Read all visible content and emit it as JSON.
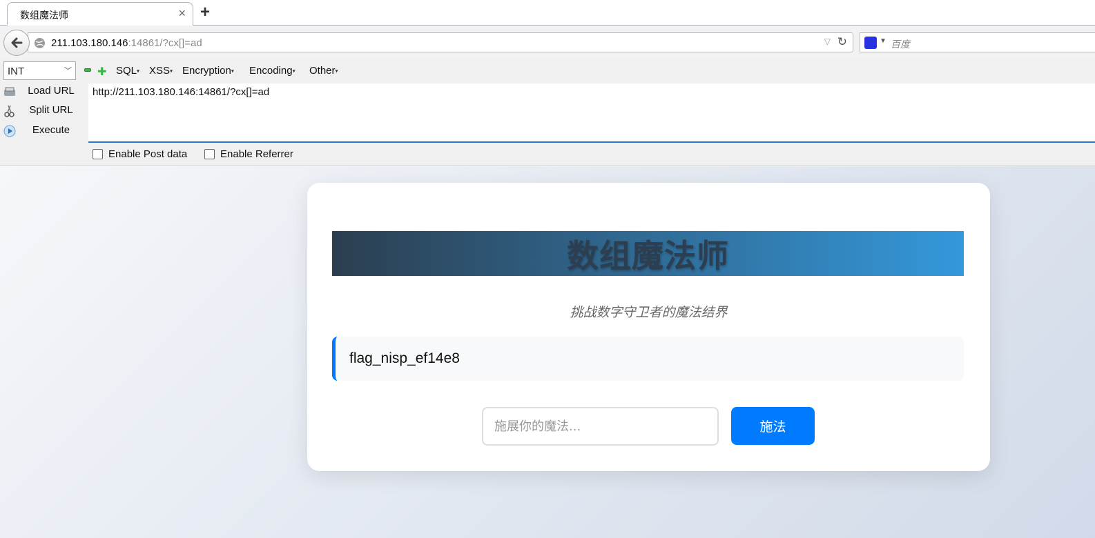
{
  "browser": {
    "tab_title": "数组魔法师",
    "tab_close": "×",
    "new_tab": "+",
    "url_host": "211.103.180.146",
    "url_rest": ":14861/?cx[]=ad",
    "search_placeholder": "百度"
  },
  "hackbar": {
    "type_select": "INT",
    "menus": [
      "SQL",
      "XSS",
      "Encryption",
      "Encoding",
      "Other"
    ],
    "load_url": "Load URL",
    "split_url": "Split URL",
    "execute": "Execute",
    "url_text": "http://211.103.180.146:14861/?cx[]=ad",
    "enable_post": "Enable Post data",
    "enable_referrer": "Enable Referrer"
  },
  "page": {
    "title": "数组魔法师",
    "subtitle": "挑战数字守卫者的魔法结界",
    "flag": "flag_nisp_ef14e8",
    "input_placeholder": "施展你的魔法...",
    "button": "施法"
  },
  "colors": {
    "accent": "#007bff",
    "banner_start": "#2c3e50",
    "banner_end": "#3498db"
  }
}
